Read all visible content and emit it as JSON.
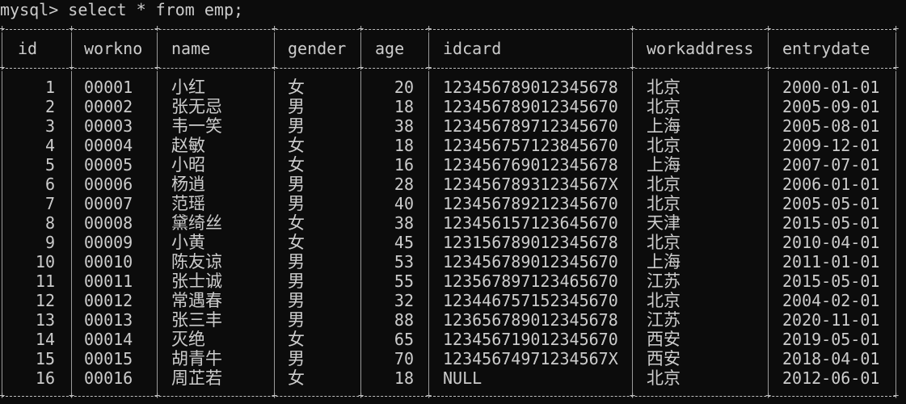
{
  "prompt": "mysql> select * from emp;",
  "table": {
    "columns": [
      "id",
      "workno",
      "name",
      "gender",
      "age",
      "idcard",
      "workaddress",
      "entrydate"
    ],
    "rows": [
      [
        "1",
        "00001",
        "小红",
        "女",
        "20",
        "123456789012345678",
        "北京",
        "2000-01-01"
      ],
      [
        "2",
        "00002",
        "张无忌",
        "男",
        "18",
        "123456789012345670",
        "北京",
        "2005-09-01"
      ],
      [
        "3",
        "00003",
        "韦一笑",
        "男",
        "38",
        "123456789712345670",
        "上海",
        "2005-08-01"
      ],
      [
        "4",
        "00004",
        "赵敏",
        "女",
        "18",
        "123456757123845670",
        "北京",
        "2009-12-01"
      ],
      [
        "5",
        "00005",
        "小昭",
        "女",
        "16",
        "123456769012345678",
        "上海",
        "2007-07-01"
      ],
      [
        "6",
        "00006",
        "杨逍",
        "男",
        "28",
        "12345678931234567X",
        "北京",
        "2006-01-01"
      ],
      [
        "7",
        "00007",
        "范瑶",
        "男",
        "40",
        "123456789212345670",
        "北京",
        "2005-05-01"
      ],
      [
        "8",
        "00008",
        "黛绮丝",
        "女",
        "38",
        "123456157123645670",
        "天津",
        "2015-05-01"
      ],
      [
        "9",
        "00009",
        "小黄",
        "女",
        "45",
        "123156789012345678",
        "北京",
        "2010-04-01"
      ],
      [
        "10",
        "00010",
        "陈友谅",
        "男",
        "53",
        "123456789012345670",
        "上海",
        "2011-01-01"
      ],
      [
        "11",
        "00011",
        "张士诚",
        "男",
        "55",
        "123567897123465670",
        "江苏",
        "2015-05-01"
      ],
      [
        "12",
        "00012",
        "常遇春",
        "男",
        "32",
        "123446757152345670",
        "北京",
        "2004-02-01"
      ],
      [
        "13",
        "00013",
        "张三丰",
        "男",
        "88",
        "123656789012345678",
        "江苏",
        "2020-11-01"
      ],
      [
        "14",
        "00014",
        "灭绝",
        "女",
        "65",
        "123456719012345670",
        "西安",
        "2019-05-01"
      ],
      [
        "15",
        "00015",
        "胡青牛",
        "男",
        "70",
        "12345674971234567X",
        "西安",
        "2018-04-01"
      ],
      [
        "16",
        "00016",
        "周芷若",
        "女",
        "18",
        "NULL",
        "北京",
        "2012-06-01"
      ]
    ]
  }
}
